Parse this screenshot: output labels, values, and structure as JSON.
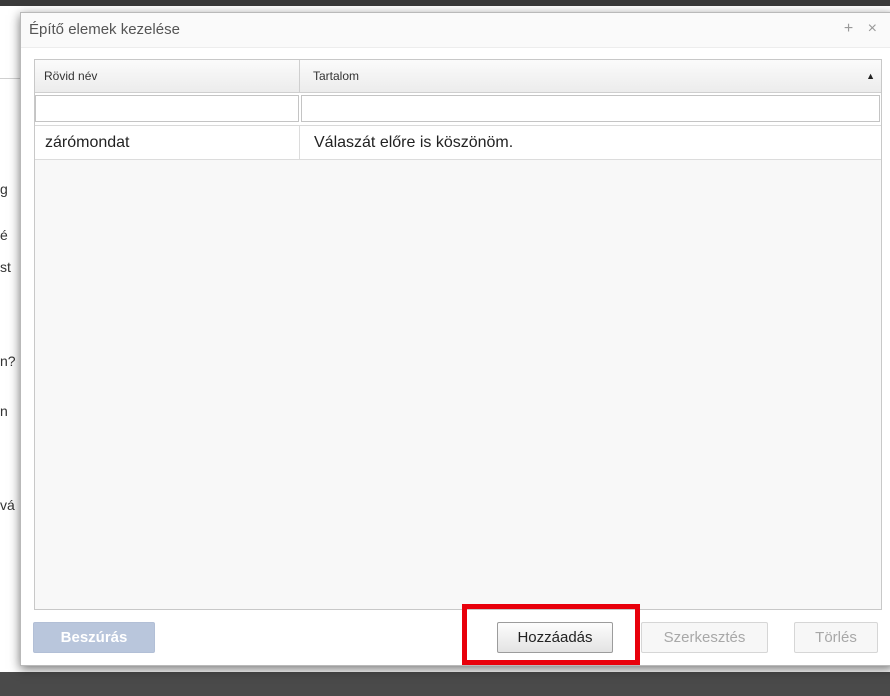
{
  "background": {
    "fragments": [
      "g",
      "é",
      "st",
      "n?",
      "n",
      "vá"
    ]
  },
  "dialog": {
    "title": "Építő elemek kezelése",
    "icons": {
      "plus": "+",
      "close": "×"
    }
  },
  "grid": {
    "columns": [
      "Rövid név",
      "Tartalom"
    ],
    "sort_icon": "▲",
    "filters": [
      "",
      ""
    ],
    "rows": [
      {
        "short_name": "zárómondat",
        "content": "Válaszát előre is köszönöm."
      }
    ]
  },
  "buttons": {
    "insert": "Beszúrás",
    "add": "Hozzáadás",
    "edit": "Szerkesztés",
    "delete": "Törlés"
  },
  "colors": {
    "highlight": "#e8000b",
    "insert_button": "#b9c6dc"
  }
}
